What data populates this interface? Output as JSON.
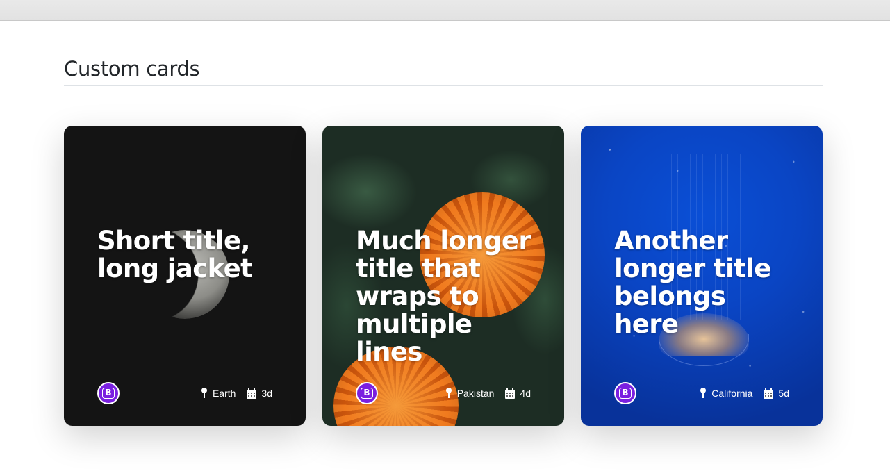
{
  "page": {
    "section_title": "Custom cards"
  },
  "cards": [
    {
      "title": "Short title, long jacket",
      "avatar_letter": "B",
      "location": "Earth",
      "date": "3d",
      "image": "moon"
    },
    {
      "title": "Much longer title that wraps to multiple lines",
      "avatar_letter": "B",
      "location": "Pakistan",
      "date": "4d",
      "image": "orange-flowers"
    },
    {
      "title": "Another longer title belongs here",
      "avatar_letter": "B",
      "location": "California",
      "date": "5d",
      "image": "jellyfish"
    }
  ],
  "icons": {
    "location": "geo-fill-icon",
    "date": "calendar-icon",
    "avatar": "bootstrap-logo-icon"
  },
  "colors": {
    "avatar_bg": "#7a1fe0",
    "card1_bg": "#141414",
    "card3_bg": "#0a45c4",
    "flower": "#f07a1e",
    "title_text": "#212529"
  }
}
